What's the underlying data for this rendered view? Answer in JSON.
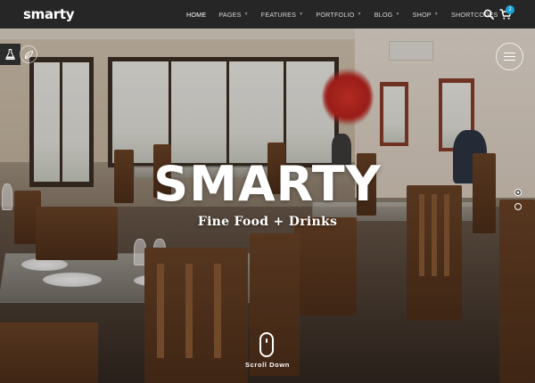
{
  "navbar": {
    "logo": "smarty",
    "menu": [
      {
        "label": "HOME",
        "active": true
      },
      {
        "label": "PAGES",
        "active": false
      },
      {
        "label": "FEATURES",
        "active": false
      },
      {
        "label": "PORTFOLIO",
        "active": false
      },
      {
        "label": "BLOG",
        "active": false
      },
      {
        "label": "SHOP",
        "active": false
      },
      {
        "label": "SHORTCODES",
        "active": false
      }
    ],
    "search_icon": "search-icon",
    "cart_icon": "cart-icon",
    "cart_count": "2"
  },
  "side": {
    "flask_icon": "flask-icon",
    "leaf_icon": "leaf-icon",
    "menu_icon": "hamburger-icon"
  },
  "hero": {
    "title": "SMARTY",
    "subtitle": "Fine Food + Drinks",
    "scroll_label": "Scroll Down",
    "slides": 2,
    "active_slide": 1
  },
  "colors": {
    "navbar": "#262626",
    "accent": "#1aa3d6",
    "text": "#ffffff"
  }
}
